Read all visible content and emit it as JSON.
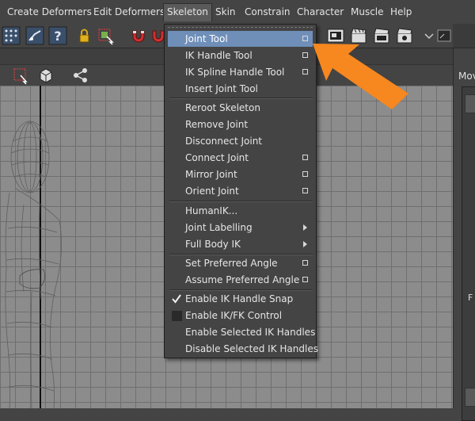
{
  "menubar": {
    "items": [
      {
        "label": "Create Deformers"
      },
      {
        "label": "Edit Deformers"
      },
      {
        "label": "Skeleton"
      },
      {
        "label": "Skin"
      },
      {
        "label": "Constrain"
      },
      {
        "label": "Character"
      },
      {
        "label": "Muscle"
      },
      {
        "label": "Help"
      }
    ]
  },
  "toolbar": {
    "help_glyph": "?"
  },
  "right_panel": {
    "title": "Mov",
    "side_letter": "F"
  },
  "skeleton_menu": {
    "items": [
      {
        "label": "Joint Tool",
        "option_box": true,
        "highlighted": true
      },
      {
        "label": "IK Handle Tool",
        "option_box": true
      },
      {
        "label": "IK Spline Handle Tool",
        "option_box": true
      },
      {
        "label": "Insert Joint Tool"
      },
      {
        "label": "Reroot Skeleton"
      },
      {
        "label": "Remove Joint"
      },
      {
        "label": "Disconnect Joint"
      },
      {
        "label": "Connect Joint",
        "option_box": true
      },
      {
        "label": "Mirror Joint",
        "option_box": true
      },
      {
        "label": "Orient Joint",
        "option_box": true
      },
      {
        "label": "HumanIK..."
      },
      {
        "label": "Joint Labelling",
        "submenu": true
      },
      {
        "label": "Full Body IK",
        "submenu": true
      },
      {
        "label": "Set Preferred Angle",
        "option_box": true
      },
      {
        "label": "Assume Preferred Angle",
        "option_box": true
      },
      {
        "label": "Enable IK Handle Snap",
        "checked": true
      },
      {
        "label": "Enable IK/FK Control",
        "checked": false
      },
      {
        "label": "Enable Selected IK Handles"
      },
      {
        "label": "Disable Selected IK Handles"
      }
    ]
  },
  "colors": {
    "highlight": "#6f8fb9",
    "annotation_arrow": "#f7871f",
    "viewport_bg": "#8c8c8c"
  }
}
